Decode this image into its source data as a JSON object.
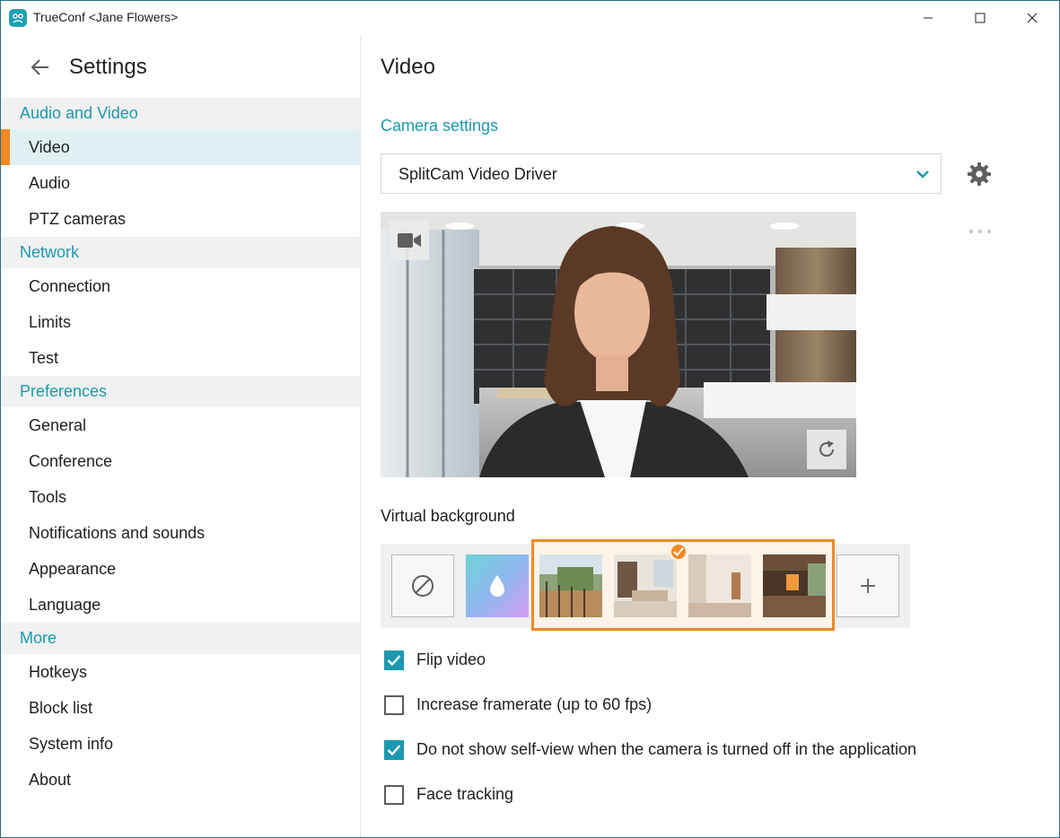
{
  "window": {
    "title": "TrueConf <Jane Flowers>"
  },
  "sidebar": {
    "title": "Settings",
    "sections": [
      {
        "label": "Audio and Video"
      },
      {
        "label": "Network"
      },
      {
        "label": "Preferences"
      },
      {
        "label": "More"
      }
    ],
    "items": [
      {
        "label": "Video"
      },
      {
        "label": "Audio"
      },
      {
        "label": "PTZ cameras"
      },
      {
        "label": "Connection"
      },
      {
        "label": "Limits"
      },
      {
        "label": "Test"
      },
      {
        "label": "General"
      },
      {
        "label": "Conference"
      },
      {
        "label": "Tools"
      },
      {
        "label": "Notifications and sounds"
      },
      {
        "label": "Appearance"
      },
      {
        "label": "Language"
      },
      {
        "label": "Hotkeys"
      },
      {
        "label": "Block list"
      },
      {
        "label": "System info"
      },
      {
        "label": "About"
      }
    ],
    "active_item": "Video"
  },
  "main": {
    "title": "Video",
    "camera_settings_label": "Camera settings",
    "camera_select": {
      "value": "SplitCam Video Driver"
    },
    "virtual_background": {
      "label": "Virtual background",
      "tiles": [
        "none",
        "blur",
        "balcony",
        "living-room",
        "empty-room",
        "lounge",
        "add"
      ],
      "selected": "living-room"
    },
    "options": [
      {
        "label": "Flip video",
        "checked": true
      },
      {
        "label": "Increase framerate (up to 60 fps)",
        "checked": false
      },
      {
        "label": "Do not show self-view when the camera is turned off in the application",
        "checked": true
      },
      {
        "label": "Face tracking",
        "checked": false
      }
    ]
  },
  "colors": {
    "accent": "#1b99ae",
    "highlight": "#f08a24",
    "active_bg": "#dff1f3",
    "section_bg": "#f1f1f1"
  },
  "icons": [
    "app-logo-icon",
    "minimize-icon",
    "maximize-icon",
    "close-icon",
    "back-arrow-icon",
    "chevron-down-icon",
    "gear-icon",
    "more-dots-icon",
    "video-camera-icon",
    "rotate-icon",
    "no-background-icon",
    "blur-drop-icon",
    "check-icon",
    "plus-icon"
  ]
}
